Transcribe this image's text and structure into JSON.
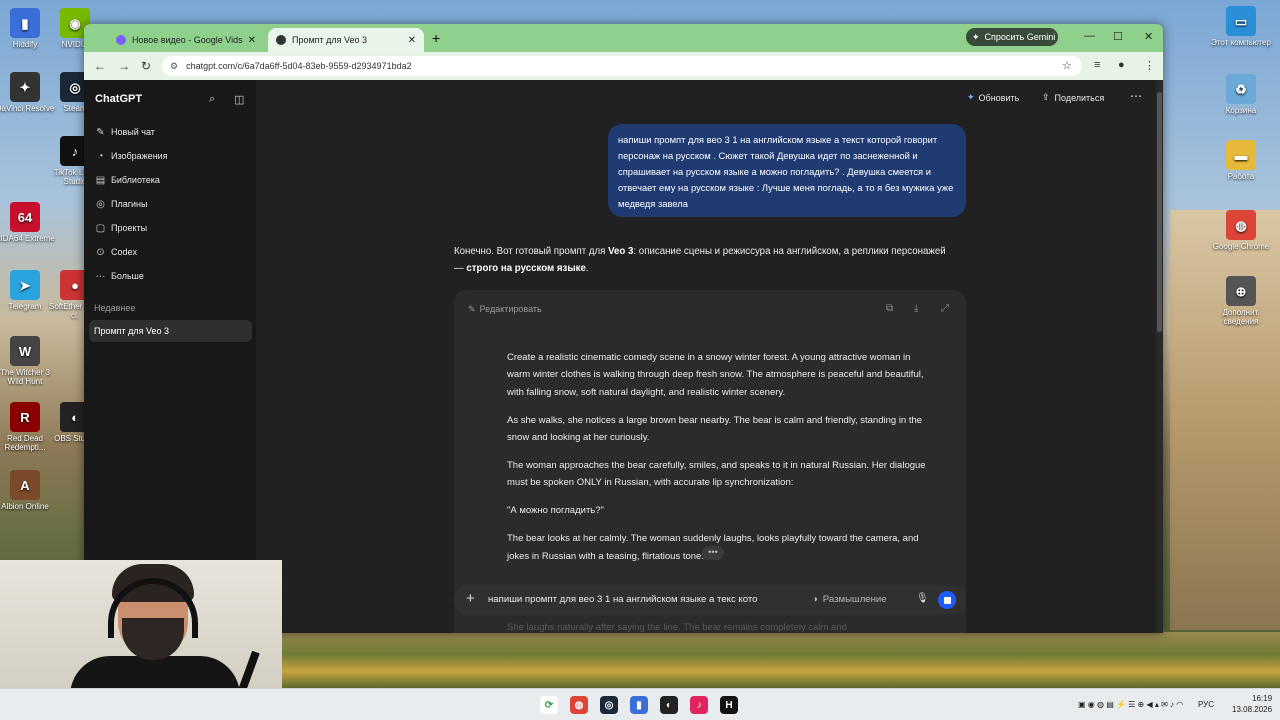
{
  "desktop": {
    "icons_left": [
      {
        "label": "Hiddify",
        "icon": "hiddify-icon",
        "color": "#3b6fd8",
        "glyph": "▮"
      },
      {
        "label": "NVIDIA",
        "icon": "nvidia-icon",
        "color": "#76b900",
        "glyph": "◉"
      },
      {
        "label": "DaVinci Resolve",
        "icon": "davinci-icon",
        "color": "#333",
        "glyph": "✦"
      },
      {
        "label": "Steam",
        "icon": "steam-icon",
        "color": "#1b2838",
        "glyph": "◎"
      },
      {
        "label": "TikTok LIVE Studio",
        "icon": "tiktok-studio-icon",
        "color": "#111",
        "glyph": "♪"
      },
      {
        "label": "AIDA64 Extreme",
        "icon": "aida64-icon",
        "color": "#c8102e",
        "glyph": "64"
      },
      {
        "label": "Telegram",
        "icon": "telegram-icon",
        "color": "#2aa3df",
        "glyph": "➤"
      },
      {
        "label": "SoftEther VPN cl.",
        "icon": "softether-icon",
        "color": "#c33",
        "glyph": "●"
      },
      {
        "label": "The Witcher 3 Wild Hunt",
        "icon": "witcher-icon",
        "color": "#444",
        "glyph": "W"
      },
      {
        "label": "Red Dead Redempti...",
        "icon": "rdr-icon",
        "color": "#8b0000",
        "glyph": "R"
      },
      {
        "label": "OBS Studio",
        "icon": "obs-icon",
        "color": "#222",
        "glyph": "◐"
      },
      {
        "label": "Albion Online",
        "icon": "albion-icon",
        "color": "#7a4a2a",
        "glyph": "A"
      }
    ],
    "icons_right": [
      {
        "label": "Этот компьютер",
        "icon": "this-pc-icon",
        "color": "#2b8fd8",
        "glyph": "▭"
      },
      {
        "label": "Корзина",
        "icon": "recycle-bin-icon",
        "color": "#6aa9d8",
        "glyph": "♻"
      },
      {
        "label": "Работа",
        "icon": "folder-icon",
        "color": "#e7b93a",
        "glyph": "▬"
      },
      {
        "label": "Google Chrome",
        "icon": "chrome-icon",
        "color": "#db4437",
        "glyph": "◍"
      },
      {
        "label": "Дополнит. сведения",
        "icon": "info-icon",
        "color": "#555",
        "glyph": "⊕"
      }
    ]
  },
  "browser": {
    "tabs": [
      {
        "title": "Новое видео - Google Vids",
        "favicon_color": "#7b61ff"
      },
      {
        "title": "Промпт для Veo 3",
        "favicon_color": "#333"
      }
    ],
    "new_tab": "+",
    "gemini_button": "Спросить Gemini",
    "url": "chatgpt.com/c/6a7da6ff-5d04-83eb-9559-d2934971bda2"
  },
  "sidebar": {
    "title": "ChatGPT",
    "items": [
      {
        "label": "Новый чат",
        "icon": "new-chat-icon",
        "glyph": "✎"
      },
      {
        "label": "Изображения",
        "icon": "images-icon",
        "glyph": "◔"
      },
      {
        "label": "Библиотека",
        "icon": "library-icon",
        "glyph": "▤"
      },
      {
        "label": "Плагины",
        "icon": "plugins-icon",
        "glyph": "◎"
      },
      {
        "label": "Проекты",
        "icon": "projects-icon",
        "glyph": "▢"
      },
      {
        "label": "Codex",
        "icon": "codex-icon",
        "glyph": "⊙"
      },
      {
        "label": "Больше",
        "icon": "more-icon",
        "glyph": "···"
      }
    ],
    "section": "Недавнее",
    "active_chat": "Промпт для Veo 3"
  },
  "header": {
    "upgrade": "Обновить",
    "share": "Поделиться",
    "more": "⋯"
  },
  "conversation": {
    "user_message": "напиши промпт для вео 3 1 на английском языке а текст которой говорит персонаж на русском . Сюжет такой Девушка идет по заснеженной и спрашивает на русском языке а можно погладить? . Девушка смеется и отвечает ему на русском языке : Лучше меня погладь, а то я без мужика уже медведя завела",
    "reply_1": "Конечно. Вот готовый промпт для ",
    "reply_bold_1": "Veo 3",
    "reply_2": ": описание сцены и режиссура на английском, а реплики персонажей — ",
    "reply_bold_2": "строго на русском языке",
    "reply_3": ".",
    "code_edit": "Редактировать",
    "code_paragraphs": [
      "Create a realistic cinematic comedy scene in a snowy winter forest. A young attractive woman in warm winter clothes is walking through deep fresh snow. The atmosphere is peaceful and beautiful, with falling snow, soft natural daylight, and realistic winter scenery.",
      "As she walks, she notices a large brown bear nearby. The bear is calm and friendly, standing in the snow and looking at her curiously.",
      "The woman approaches the bear carefully, smiles, and speaks to it in natural Russian. Her dialogue must be spoken ONLY in Russian, with accurate lip synchronization:",
      "\"А можно погладить?\"",
      "The bear looks at her calmly. The woman suddenly laughs, looks playfully toward the camera, and jokes in Russian with a teasing, flirtatious tone:"
    ],
    "faded_line": "She laughs naturally after saying the line. The bear remains completely calm and",
    "dots": "•••"
  },
  "composer": {
    "text": "напиши промпт для вео 3 1 на английском языке а текс кото",
    "thinking": "Размышление"
  },
  "taskbar": {
    "language": "РУС",
    "time": "16:19",
    "date": "13.08.2026"
  }
}
